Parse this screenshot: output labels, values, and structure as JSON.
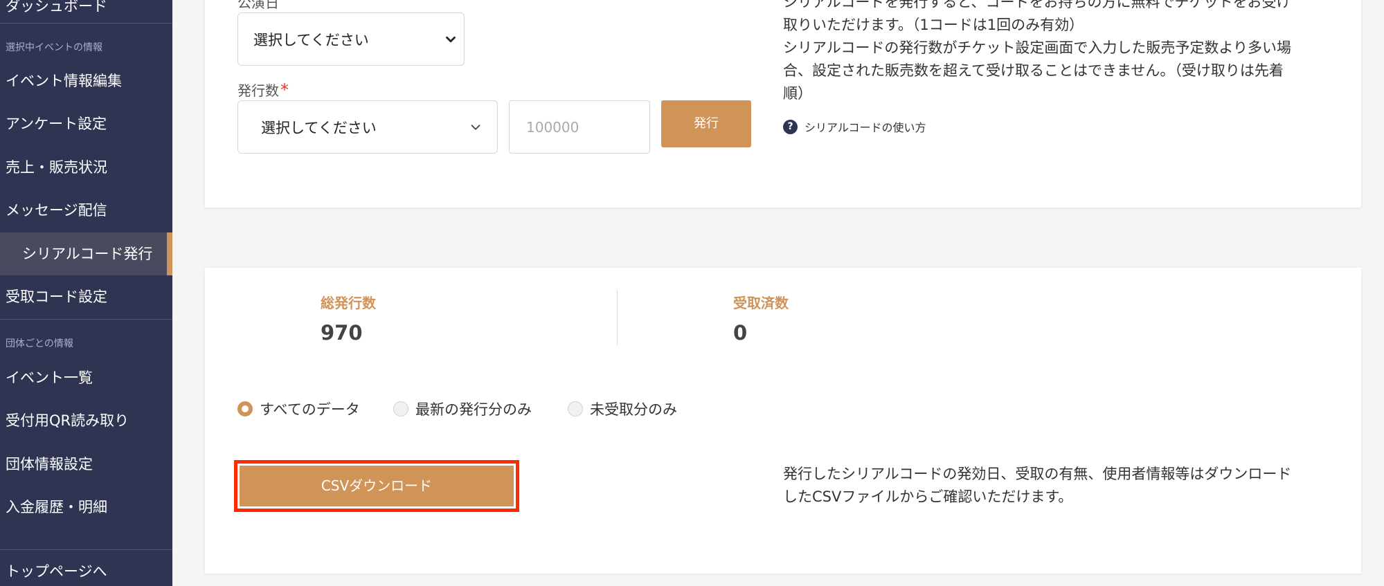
{
  "sidebar": {
    "top_item": "ダッシュボード",
    "section1": "選択中イベントの情報",
    "items1": [
      "イベント情報編集",
      "アンケート設定",
      "売上・販売状況",
      "メッセージ配信",
      "シリアルコード発行",
      "受取コード設定"
    ],
    "active_index": 4,
    "section2": "団体ごとの情報",
    "items2": [
      "イベント一覧",
      "受付用QR読み取り",
      "団体情報設定",
      "入金履歴・明細"
    ],
    "bottom_item": "トップページへ"
  },
  "form": {
    "date_label": "公演日",
    "date_select": "選択してください",
    "count_label": "発行数",
    "required_mark": "*",
    "count_select": "選択してください",
    "quantity_placeholder": "100000",
    "issue_button": "発行",
    "desc_lines": [
      "シリアルコードを発行すると、コードをお持ちの方に無料でチケットをお受け",
      "取りいただけます。（1コードは1回のみ有効）",
      "シリアルコードの発行数がチケット設定画面で入力した販売予定数より多い場",
      "合、設定された販売数を超えて受け取ることはできません。（受け取りは先着",
      "順）"
    ],
    "help_link": "シリアルコードの使い方"
  },
  "stats": {
    "total_label": "総発行数",
    "total_value": "970",
    "received_label": "受取済数",
    "received_value": "0"
  },
  "filters": {
    "options": [
      "すべてのデータ",
      "最新の発行分のみ",
      "未受取分のみ"
    ],
    "selected_index": 0
  },
  "download": {
    "button": "CSVダウンロード",
    "desc_lines": [
      "発行したシリアルコードの発効日、受取の有無、使用者情報等はダウンロード",
      "したCSVファイルからご確認いただけます。"
    ]
  },
  "colors": {
    "sidebar_bg": "#2e3452",
    "accent": "#d09358",
    "highlight_border": "#ff2a00"
  }
}
